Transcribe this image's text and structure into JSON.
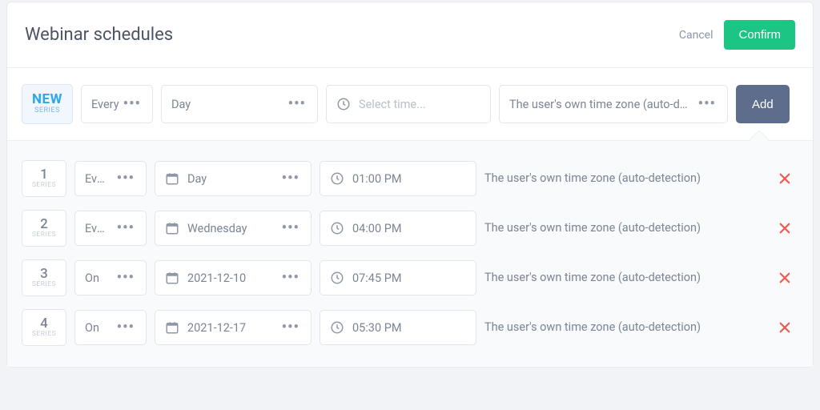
{
  "header": {
    "title": "Webinar schedules",
    "cancel_label": "Cancel",
    "confirm_label": "Confirm"
  },
  "builder": {
    "badge_top": "NEW",
    "badge_bottom": "SERIES",
    "mode_label": "Every",
    "day_label": "Day",
    "time_placeholder": "Select time...",
    "tz_label": "The user's own time zone (auto-d…",
    "add_label": "Add"
  },
  "series_caption": "SERIES",
  "rows": [
    {
      "num": "1",
      "mode": "Every",
      "day": "Day",
      "time": "01:00 PM",
      "tz": "The user's own time zone (auto-detection)"
    },
    {
      "num": "2",
      "mode": "Every",
      "day": "Wednesday",
      "time": "04:00 PM",
      "tz": "The user's own time zone (auto-detection)"
    },
    {
      "num": "3",
      "mode": "On",
      "day": "2021-12-10",
      "time": "07:45 PM",
      "tz": "The user's own time zone (auto-detection)"
    },
    {
      "num": "4",
      "mode": "On",
      "day": "2021-12-17",
      "time": "05:30 PM",
      "tz": "The user's own time zone (auto-detection)"
    }
  ]
}
